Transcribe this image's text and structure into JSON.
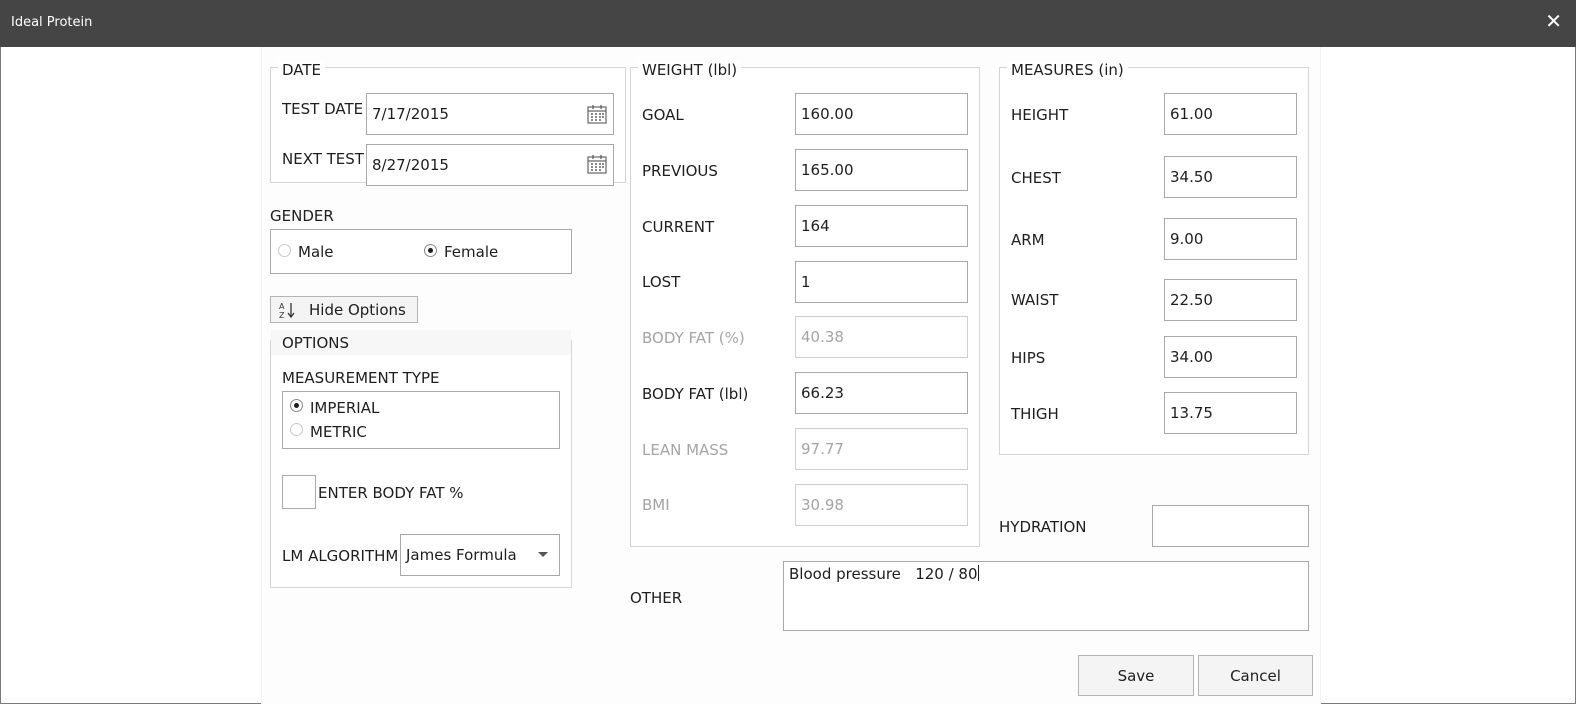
{
  "window": {
    "title": "Ideal Protein",
    "close_glyph": "✕"
  },
  "date": {
    "group_title": "DATE",
    "test_date_label": "TEST DATE",
    "test_date_value": "7/17/2015",
    "next_test_label": "NEXT TEST",
    "next_test_value": "8/27/2015"
  },
  "gender": {
    "label": "GENDER",
    "options": [
      "Male",
      "Female"
    ],
    "selected": "Female"
  },
  "options_toggle": {
    "label": "Hide Options",
    "icon": "sort-az-icon"
  },
  "options": {
    "group_title": "OPTIONS",
    "measurement_type_label": "MEASUREMENT TYPE",
    "measurement_options": [
      "IMPERIAL",
      "METRIC"
    ],
    "measurement_selected": "IMPERIAL",
    "enter_body_fat_label": "ENTER BODY FAT %",
    "enter_body_fat_checked": false,
    "lm_algorithm_label": "LM ALGORITHM",
    "lm_algorithm_value": "James Formula"
  },
  "weight": {
    "group_title": "WEIGHT (lbl)",
    "goal_label": "GOAL",
    "goal_value": "160.00",
    "previous_label": "PREVIOUS",
    "previous_value": "165.00",
    "current_label": "CURRENT",
    "current_value": "164",
    "lost_label": "LOST",
    "lost_value": "1",
    "body_fat_pct_label": "BODY FAT (%)",
    "body_fat_pct_value": "40.38",
    "body_fat_lbl_label": "BODY FAT (lbl)",
    "body_fat_lbl_value": "66.23",
    "lean_mass_label": "LEAN MASS",
    "lean_mass_value": "97.77",
    "bmi_label": "BMI",
    "bmi_value": "30.98"
  },
  "measures": {
    "group_title": "MEASURES (in)",
    "height_label": "HEIGHT",
    "height_value": "61.00",
    "chest_label": "CHEST",
    "chest_value": "34.50",
    "arm_label": "ARM",
    "arm_value": "9.00",
    "waist_label": "WAIST",
    "waist_value": "22.50",
    "hips_label": "HIPS",
    "hips_value": "34.00",
    "thigh_label": "THIGH",
    "thigh_value": "13.75"
  },
  "hydration": {
    "label": "HYDRATION",
    "value": ""
  },
  "other": {
    "label": "OTHER",
    "value": "Blood pressure   120 / 80"
  },
  "actions": {
    "save_label": "Save",
    "cancel_label": "Cancel"
  }
}
